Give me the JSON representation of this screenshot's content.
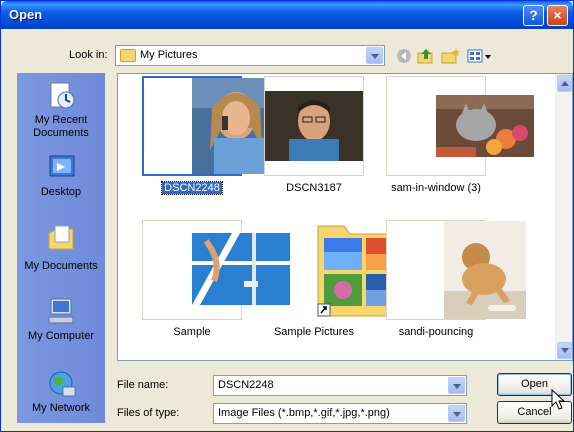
{
  "window": {
    "title": "Open",
    "help_glyph": "?",
    "close_glyph": "×"
  },
  "lookin": {
    "label": "Look in:",
    "value": "My Pictures"
  },
  "places": [
    {
      "label": "My Recent Documents",
      "icon": "recent-documents-icon"
    },
    {
      "label": "Desktop",
      "icon": "desktop-icon"
    },
    {
      "label": "My Documents",
      "icon": "my-documents-icon"
    },
    {
      "label": "My Computer",
      "icon": "my-computer-icon"
    },
    {
      "label": "My Network",
      "icon": "my-network-icon"
    }
  ],
  "files": [
    {
      "name": "DSCN2248",
      "selected": true
    },
    {
      "name": "DSCN3187",
      "selected": false
    },
    {
      "name": "sam-in-window (3)",
      "selected": false
    },
    {
      "name": "Sample",
      "selected": false
    },
    {
      "name": "Sample Pictures",
      "selected": false
    },
    {
      "name": "sandi-pouncing",
      "selected": false
    }
  ],
  "filename": {
    "label": "File name:",
    "value": "DSCN2248"
  },
  "filetype": {
    "label": "Files of type:",
    "value": "Image Files (*.bmp,*.gif,*.jpg,*.png)"
  },
  "buttons": {
    "open": "Open",
    "cancel": "Cancel"
  },
  "colors": {
    "selection": "#316ac5",
    "title_bar": "#0a5fe6",
    "places_bar": "#7a96df"
  }
}
